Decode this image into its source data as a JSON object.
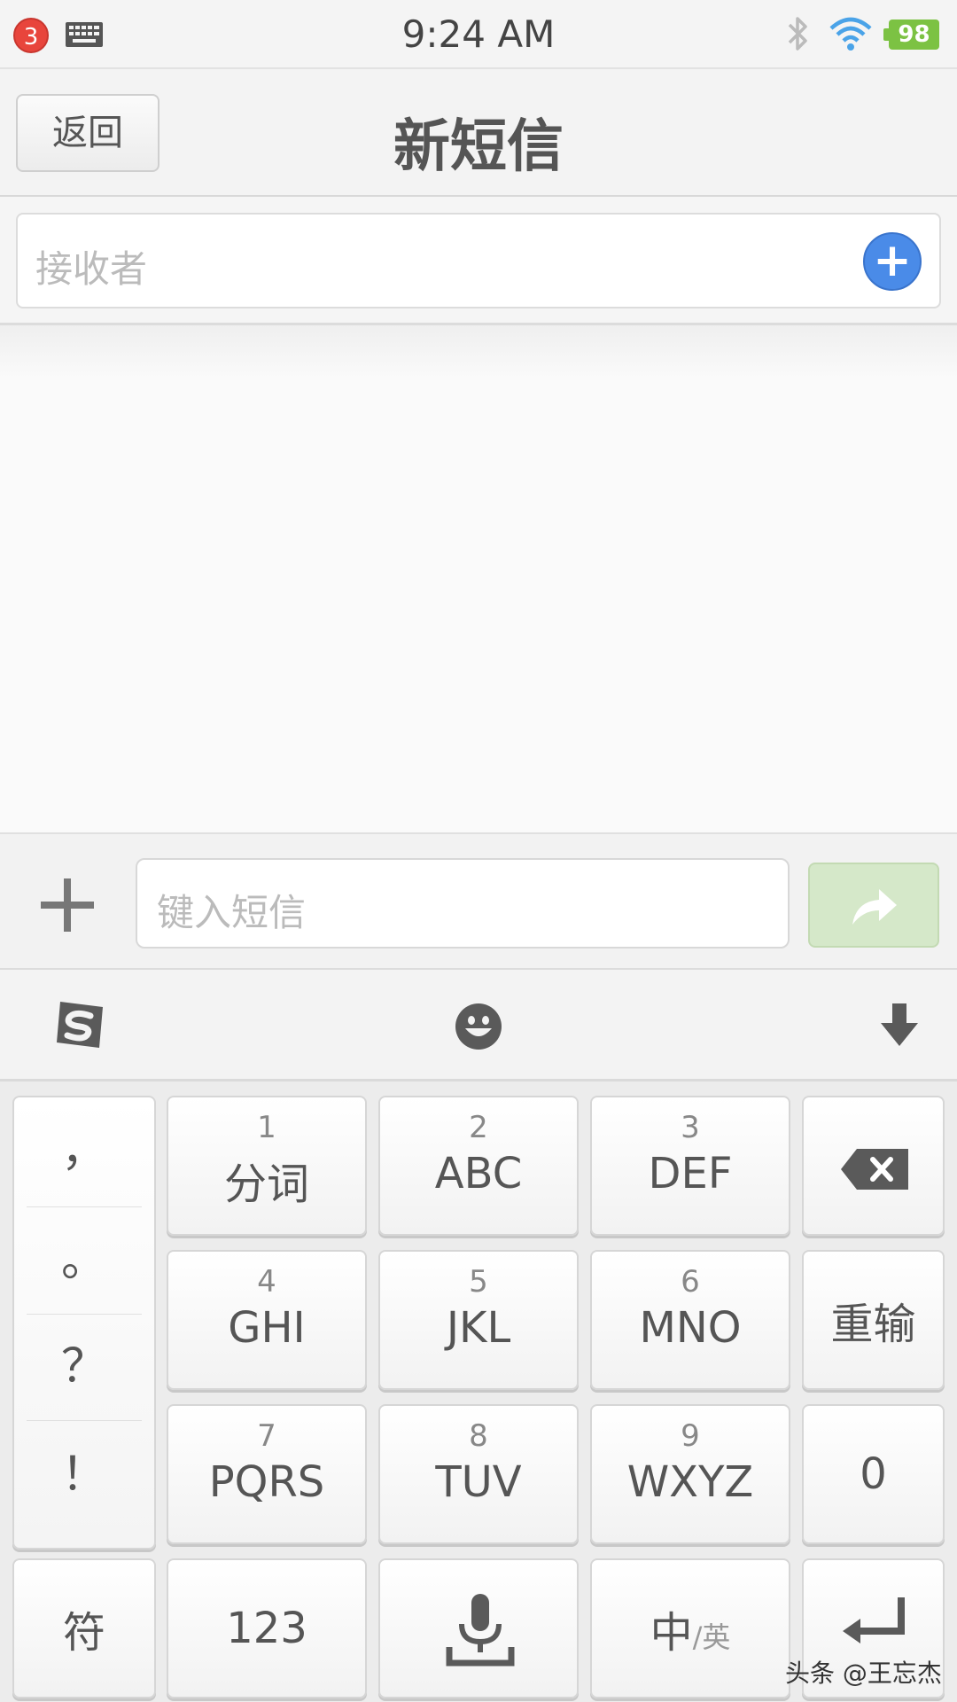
{
  "status_bar": {
    "notification_count": "3",
    "time": "9:24 AM",
    "battery": "98",
    "icons": [
      "keyboard-icon",
      "bluetooth-icon",
      "wifi-icon",
      "battery-icon"
    ]
  },
  "header": {
    "back_label": "返回",
    "title": "新短信"
  },
  "recipient": {
    "placeholder": "接收者",
    "add_icon": "plus-circle-icon"
  },
  "compose": {
    "placeholder": "键入短信",
    "attach_icon": "plus-icon",
    "send_icon": "forward-arrow-icon"
  },
  "ime_toolbar": {
    "icons": [
      "sogou-logo-icon",
      "emoji-icon",
      "hide-keyboard-icon"
    ]
  },
  "keyboard": {
    "punctuation": [
      "，",
      "。",
      "？",
      "！"
    ],
    "keys": [
      {
        "num": "1",
        "label": "分词"
      },
      {
        "num": "2",
        "label": "ABC"
      },
      {
        "num": "3",
        "label": "DEF"
      },
      {
        "num": "4",
        "label": "GHI"
      },
      {
        "num": "5",
        "label": "JKL"
      },
      {
        "num": "6",
        "label": "MNO"
      },
      {
        "num": "7",
        "label": "PQRS"
      },
      {
        "num": "8",
        "label": "TUV"
      },
      {
        "num": "9",
        "label": "WXYZ"
      }
    ],
    "reset_label": "重输",
    "zero_label": "0",
    "symbol_label": "符",
    "num_label": "123",
    "lang_main": "中",
    "lang_alt": "/英"
  },
  "watermark": "头条 @王忘杰",
  "colors": {
    "accent_blue": "#4a8be8",
    "send_green": "#d5e8c9",
    "battery_green": "#7cc243",
    "badge_red": "#e8453c"
  }
}
